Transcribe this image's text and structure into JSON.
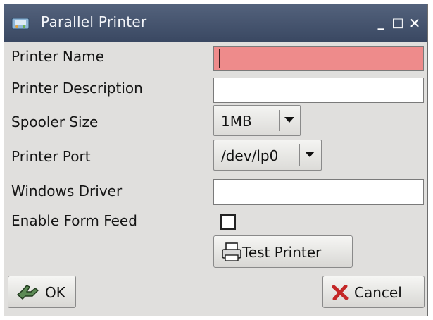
{
  "window": {
    "title": "Parallel Printer",
    "minimize_glyph": "_",
    "maximize_glyph": "□",
    "close_glyph": "✕"
  },
  "form": {
    "printer_name": {
      "label": "Printer Name",
      "value": ""
    },
    "printer_description": {
      "label": "Printer Description",
      "value": ""
    },
    "spooler_size": {
      "label": "Spooler Size",
      "selected": "1MB"
    },
    "printer_port": {
      "label": "Printer Port",
      "selected": "/dev/lp0"
    },
    "windows_driver": {
      "label": "Windows Driver",
      "value": ""
    },
    "enable_form_feed": {
      "label": "Enable Form Feed",
      "checked": false
    }
  },
  "buttons": {
    "test_printer": "Test Printer",
    "ok": "OK",
    "cancel": "Cancel"
  },
  "colors": {
    "titlebar": "#44526c",
    "error_field": "#ee8b8b",
    "dialog_bg": "#e0dfdd",
    "cancel_x": "#c42727"
  },
  "icons": {
    "app": "printer-app-icon",
    "test_printer": "printer-icon",
    "ok": "checkmark-hand-icon",
    "cancel": "red-x-icon"
  }
}
